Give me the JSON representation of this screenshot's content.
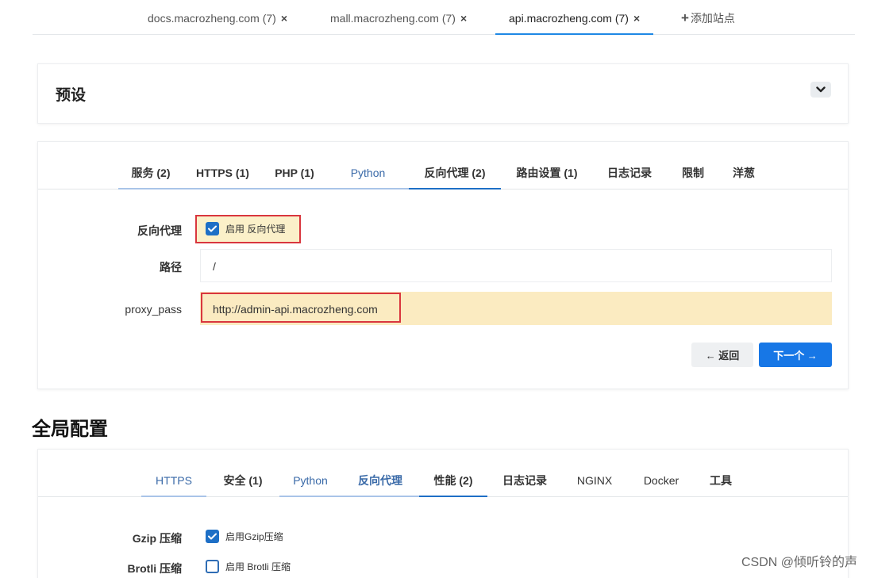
{
  "site_tabs": [
    {
      "label": "docs.macrozheng.com (7)",
      "close": "×",
      "active": false
    },
    {
      "label": "mall.macrozheng.com (7)",
      "close": "×",
      "active": false
    },
    {
      "label": "api.macrozheng.com (7)",
      "close": "×",
      "active": true
    }
  ],
  "add_site": {
    "plus": "+",
    "label": "添加站点"
  },
  "preset": {
    "title": "预设"
  },
  "proxy_card": {
    "tabs": [
      {
        "label": "服务 (2)"
      },
      {
        "label": "HTTPS (1)"
      },
      {
        "label": "PHP (1)"
      },
      {
        "label": "Python"
      },
      {
        "label": "反向代理 (2)"
      },
      {
        "label": "路由设置 (1)"
      },
      {
        "label": "日志记录"
      },
      {
        "label": "限制"
      },
      {
        "label": "洋葱"
      }
    ],
    "rows": {
      "enable_label": "反向代理",
      "enable_checkbox": "启用 反向代理",
      "path_label": "路径",
      "path_value": "/",
      "proxy_pass_label": "proxy_pass",
      "proxy_pass_value": "http://admin-api.macrozheng.com"
    },
    "buttons": {
      "back": "← 返回",
      "next": "下一个 →"
    }
  },
  "global": {
    "title": "全局配置",
    "tabs": [
      {
        "label": "HTTPS"
      },
      {
        "label": "安全 (1)"
      },
      {
        "label": "Python"
      },
      {
        "label": "反向代理"
      },
      {
        "label": "性能 (2)"
      },
      {
        "label": "日志记录"
      },
      {
        "label": "NGINX"
      },
      {
        "label": "Docker"
      },
      {
        "label": "工具"
      }
    ],
    "rows": {
      "gzip_label": "Gzip 压缩",
      "gzip_checkbox": "启用Gzip压缩",
      "brotli_label": "Brotli 压缩",
      "brotli_checkbox": "启用 Brotli 压缩"
    }
  },
  "watermark": "CSDN @倾听铃的声",
  "colors": {
    "accent": "#1e6fc6",
    "highlight": "#fbebc1",
    "annotation_red": "#d9363e"
  }
}
